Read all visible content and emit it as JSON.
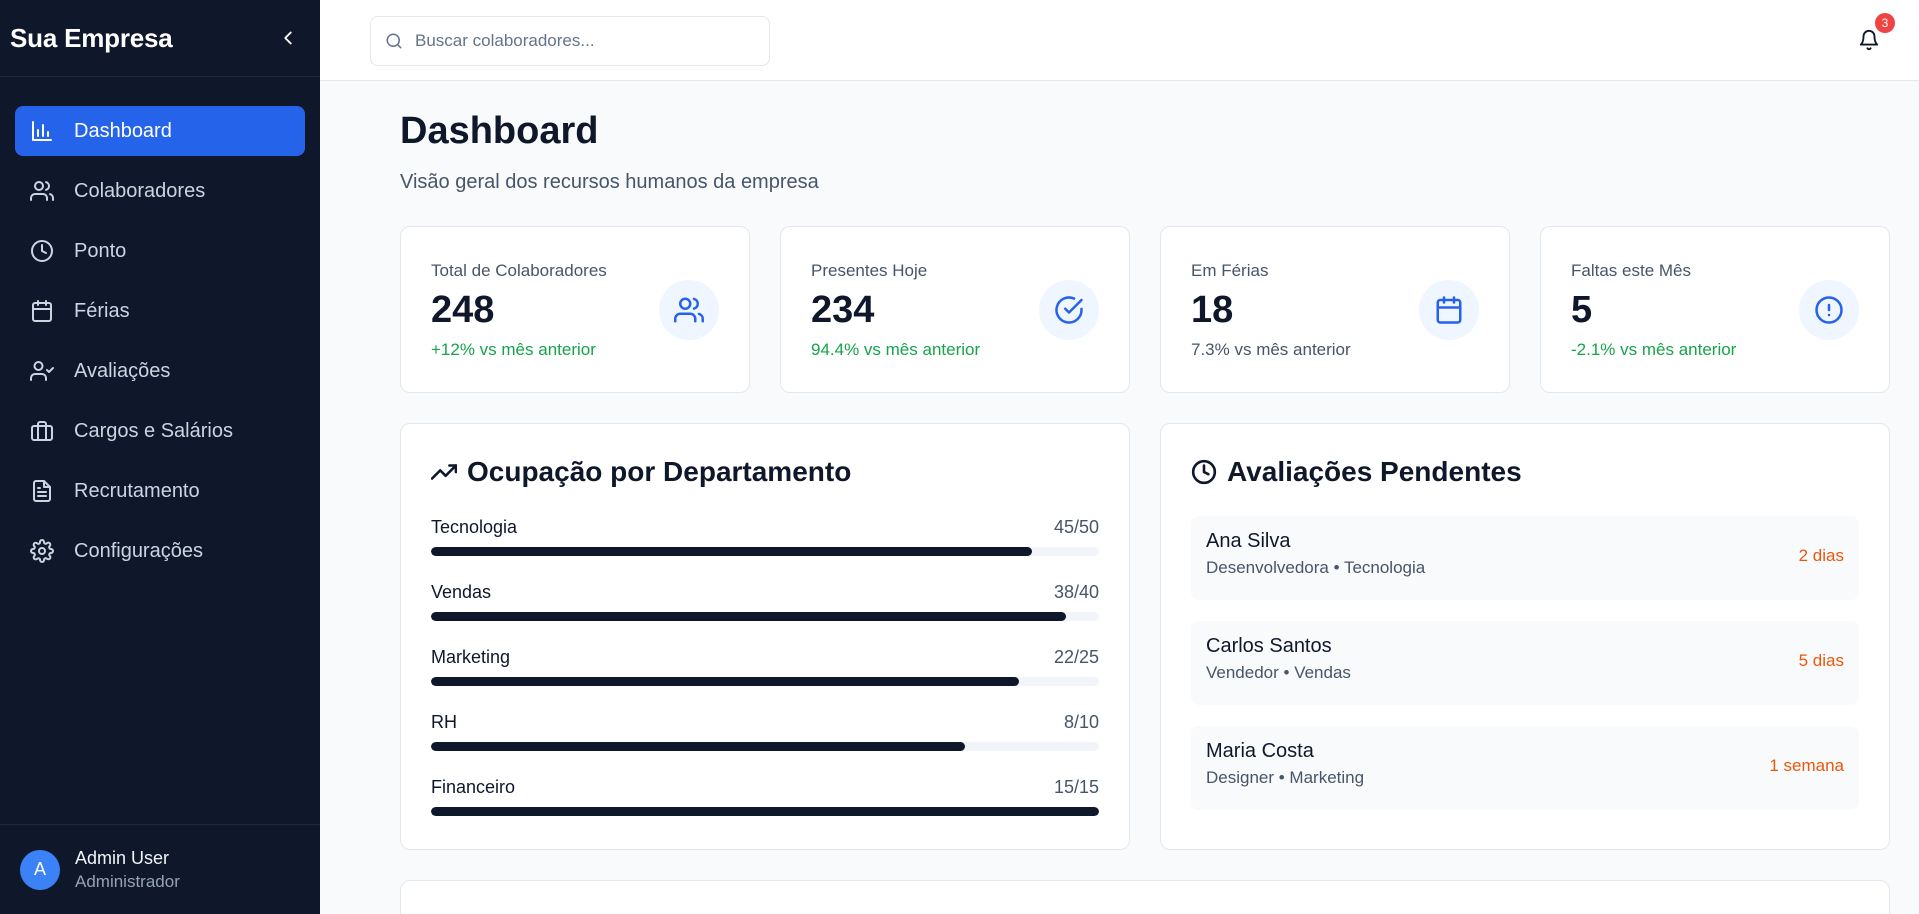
{
  "brand": {
    "name": "Sua Empresa"
  },
  "sidebar": {
    "items": [
      {
        "label": "Dashboard",
        "icon": "bar-chart-icon",
        "active": true
      },
      {
        "label": "Colaboradores",
        "icon": "users-icon"
      },
      {
        "label": "Ponto",
        "icon": "clock-icon"
      },
      {
        "label": "Férias",
        "icon": "calendar-icon"
      },
      {
        "label": "Avaliações",
        "icon": "user-check-icon"
      },
      {
        "label": "Cargos e Salários",
        "icon": "briefcase-icon"
      },
      {
        "label": "Recrutamento",
        "icon": "file-text-icon"
      },
      {
        "label": "Configurações",
        "icon": "gear-icon"
      }
    ],
    "user": {
      "initial": "A",
      "name": "Admin User",
      "role": "Administrador"
    }
  },
  "topbar": {
    "search_placeholder": "Buscar colaboradores...",
    "notifications_count": "3"
  },
  "page": {
    "title": "Dashboard",
    "subtitle": "Visão geral dos recursos humanos da empresa"
  },
  "stats": [
    {
      "label": "Total de Colaboradores",
      "value": "248",
      "change": "+12% vs mês anterior",
      "icon": "users-icon"
    },
    {
      "label": "Presentes Hoje",
      "value": "234",
      "change": "94.4% vs mês anterior",
      "icon": "check-circle-icon"
    },
    {
      "label": "Em Férias",
      "value": "18",
      "change": "7.3% vs mês anterior",
      "icon": "calendar-icon"
    },
    {
      "label": "Faltas este Mês",
      "value": "5",
      "change": "-2.1% vs mês anterior",
      "icon": "alert-circle-icon"
    }
  ],
  "occupancy": {
    "title": "Ocupação por Departamento",
    "departments": [
      {
        "name": "Tecnologia",
        "count": "45/50",
        "ratio": 0.9
      },
      {
        "name": "Vendas",
        "count": "38/40",
        "ratio": 0.95
      },
      {
        "name": "Marketing",
        "count": "22/25",
        "ratio": 0.88
      },
      {
        "name": "RH",
        "count": "8/10",
        "ratio": 0.8
      },
      {
        "name": "Financeiro",
        "count": "15/15",
        "ratio": 1.0
      }
    ]
  },
  "pending": {
    "title": "Avaliações Pendentes",
    "items": [
      {
        "name": "Ana Silva",
        "meta": "Desenvolvedora • Tecnologia",
        "due": "2 dias"
      },
      {
        "name": "Carlos Santos",
        "meta": "Vendedor • Vendas",
        "due": "5 dias"
      },
      {
        "name": "Maria Costa",
        "meta": "Designer • Marketing",
        "due": "1 semana"
      }
    ]
  },
  "colors": {
    "sidebar_bg": "#0f172a",
    "accent": "#2563eb",
    "positive": "#16a34a",
    "neutral": "#475569",
    "warning": "#ea580c",
    "badge": "#ef4444"
  }
}
